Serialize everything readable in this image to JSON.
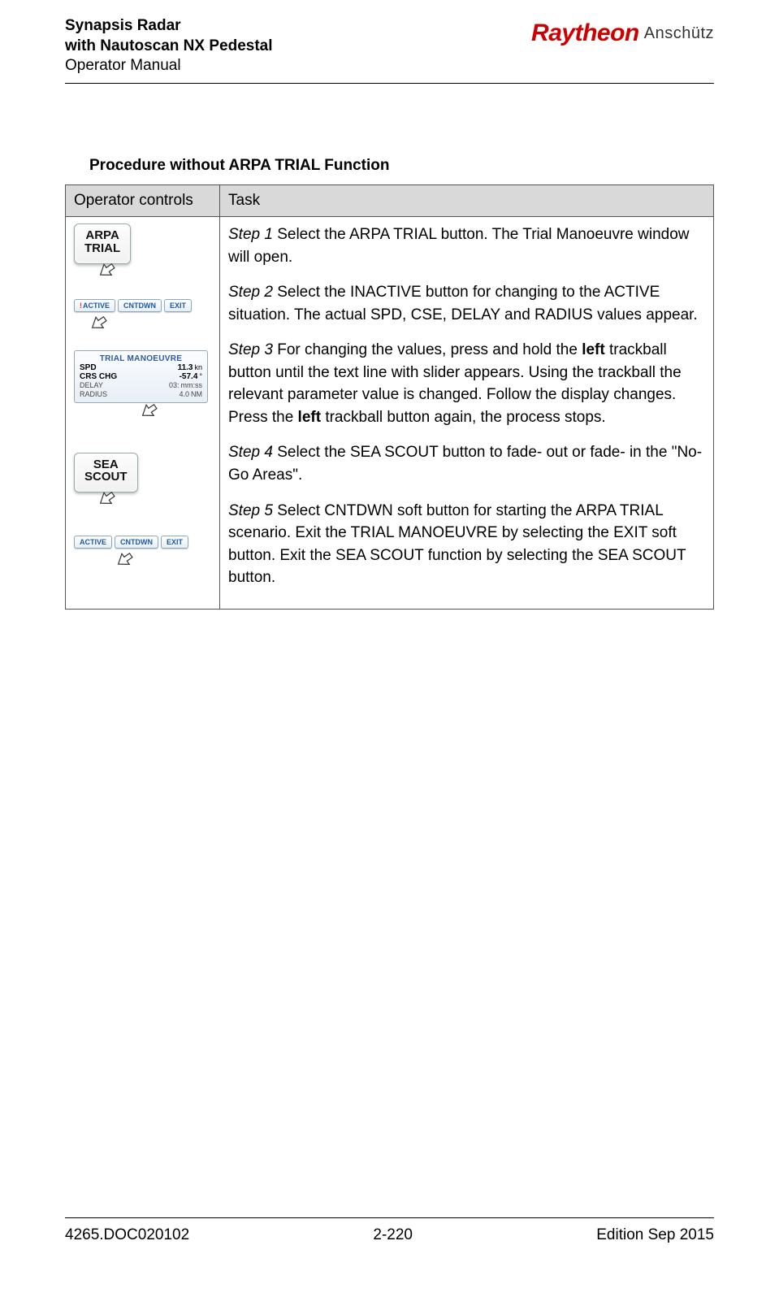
{
  "header": {
    "title_line1": "Synapsis Radar",
    "title_line2": "with Nautoscan NX Pedestal",
    "subtitle": "Operator Manual",
    "brand1": "Raytheon",
    "brand2": "Anschütz"
  },
  "section_title": "Procedure without ARPA TRIAL Function",
  "table": {
    "col1_header": "Operator controls",
    "col2_header": "Task"
  },
  "controls": {
    "btn_arpa_l1": "ARPA",
    "btn_arpa_l2": "TRIAL",
    "row1_b1_prefix": "!",
    "row1_b1": "ACTIVE",
    "row1_b2": "CNTDWN",
    "row1_b3": "EXIT",
    "panel_title": "TRIAL MANOEUVRE",
    "p_spd_lbl": "SPD",
    "p_spd_val": "11.3",
    "p_spd_unit": "kn",
    "p_crs_lbl": "CRS CHG",
    "p_crs_val": "-57.4",
    "p_crs_unit": "°",
    "p_delay_lbl": "DELAY",
    "p_delay_val": "03:",
    "p_delay_unit": "mm:ss",
    "p_radius_lbl": "RADIUS",
    "p_radius_val": "4.0",
    "p_radius_unit": "NM",
    "btn_sea_l1": "SEA",
    "btn_sea_l2": "SCOUT",
    "row2_b1": "ACTIVE",
    "row2_b2": "CNTDWN",
    "row2_b3": "EXIT"
  },
  "steps": {
    "s1_label": "Step 1",
    "s1_text": " Select the ARPA TRIAL button. The Trial Manoeuvre window will open.",
    "s2_label": "Step 2",
    "s2_text": " Select the INACTIVE button for changing to the ACTIVE situation. The actual SPD, CSE, DELAY and RADIUS values appear.",
    "s3_label": "Step 3",
    "s3_text_a": " For changing the values, press and hold the ",
    "s3_bold_a": "left",
    "s3_text_b": " trackball button until the text line with slider appears. Using the trackball the relevant parameter value is changed. Follow the display changes. Press the ",
    "s3_bold_b": "left",
    "s3_text_c": " trackball button again, the process stops.",
    "s4_label": "Step 4",
    "s4_text": " Select the SEA SCOUT button to fade- out or fade- in the \"No- Go Areas\".",
    "s5_label": "Step 5",
    "s5_text": " Select CNTDWN soft button for starting the ARPA TRIAL scenario. Exit the TRIAL MANOEUVRE by selecting the EXIT soft button. Exit the SEA SCOUT function by selecting the SEA SCOUT button."
  },
  "footer": {
    "left": "4265.DOC020102",
    "center": "2-220",
    "right": "Edition Sep 2015"
  }
}
